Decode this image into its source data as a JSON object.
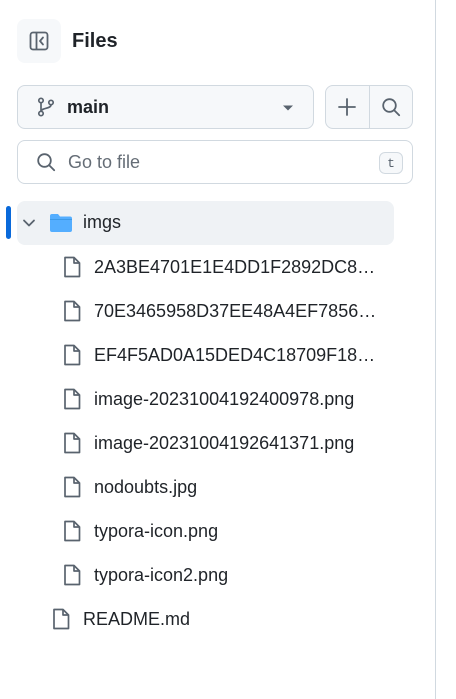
{
  "header": {
    "title": "Files",
    "toggle_icon": "sidebar-collapse-icon"
  },
  "branch": {
    "name": "main",
    "icon": "git-branch-icon"
  },
  "actions": {
    "add_icon": "plus-icon",
    "search_icon": "search-icon"
  },
  "search": {
    "placeholder": "Go to file",
    "shortcut": "t"
  },
  "tree": {
    "folder": {
      "label": "imgs",
      "expanded": true,
      "files": [
        "2A3BE4701E1E4DD1F2892DC8F…",
        "70E3465958D37EE48A4EF7856D…",
        "EF4F5AD0A15DED4C18709F183…",
        "image-20231004192400978.png",
        "image-20231004192641371.png",
        "nodoubts.jpg",
        "typora-icon.png",
        "typora-icon2.png"
      ]
    },
    "root_files": [
      "README.md"
    ]
  },
  "colors": {
    "accent": "#0969da",
    "folder": "#54aeff",
    "border": "#d1d9e0",
    "muted": "#59636e"
  }
}
